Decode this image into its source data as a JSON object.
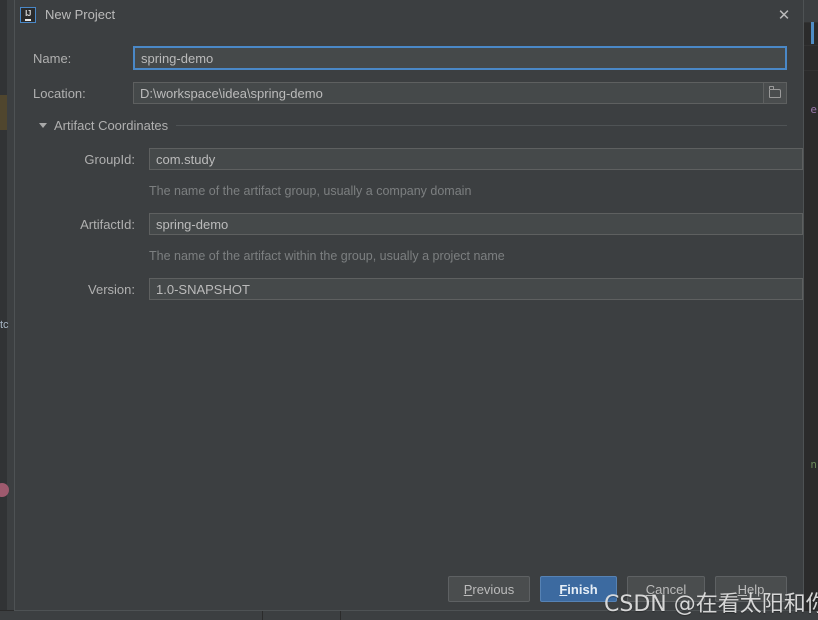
{
  "dialog": {
    "title": "New Project",
    "icon": "intellij-idea-logo",
    "close_label": "✕"
  },
  "form": {
    "name": {
      "label": "Name:",
      "value": "spring-demo",
      "focused": true
    },
    "location": {
      "label": "Location:",
      "value": "D:\\workspace\\idea\\spring-demo",
      "browse_icon": "folder-icon"
    }
  },
  "artifact_section": {
    "title": "Artifact Coordinates",
    "expanded": true,
    "fields": {
      "group_id": {
        "label": "GroupId:",
        "value": "com.study",
        "hint": "The name of the artifact group, usually a company domain"
      },
      "artifact_id": {
        "label": "ArtifactId:",
        "value": "spring-demo",
        "hint": "The name of the artifact within the group, usually a project name"
      },
      "version": {
        "label": "Version:",
        "value": "1.0-SNAPSHOT"
      }
    }
  },
  "buttons": {
    "previous": {
      "label": "Previous",
      "mnemonic": "P"
    },
    "finish": {
      "label": "Finish",
      "mnemonic": "F",
      "default": true
    },
    "cancel": {
      "label": "Cancel",
      "mnemonic": "C"
    },
    "help": {
      "label": "Help",
      "mnemonic": "H"
    }
  },
  "watermark": {
    "text": "CSDN @在看太阳和你"
  },
  "background": {
    "left_text": "tc",
    "code_fragments": [
      "e",
      "n"
    ]
  },
  "colors": {
    "dialog_bg": "#3c3f41",
    "editor_bg": "#2b2b2b",
    "field_bg": "#45494a",
    "accent_blue": "#4a88c7",
    "default_button": "#3c6aa0",
    "text": "#bbbbbb",
    "hint_text": "#7c7f80"
  }
}
